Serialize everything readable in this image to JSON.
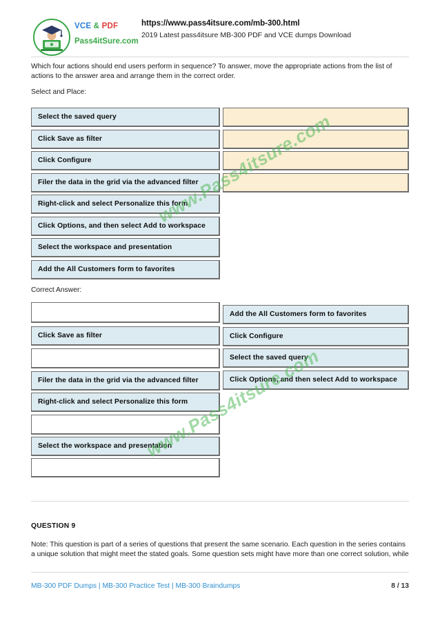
{
  "header": {
    "brand": {
      "vce": "VCE",
      "amp": "&",
      "pdf": "PDF",
      "site": "Pass4itSure.com"
    },
    "url": "https://www.pass4itsure.com/mb-300.html",
    "subtitle": "2019 Latest pass4itsure MB-300 PDF and VCE dumps Download",
    "logo_icon": "graduate-laptop-icon"
  },
  "question": {
    "prompt": "Which four actions should end users perform in sequence? To answer, move the appropriate actions from the list of actions to the answer area and arrange them in the correct order.",
    "select_and_place_label": "Select and Place:",
    "correct_answer_label": "Correct Answer:"
  },
  "select_and_place": {
    "actions_list": [
      "Select the saved query",
      "Click Save as filter",
      "Click Configure",
      "Filer the data in the grid via the advanced filter",
      "Right-click and select Personalize this form",
      "Click Options, and then select Add to workspace",
      "Select the workspace and presentation",
      "Add the All Customers form to favorites"
    ],
    "answer_slots": [
      "",
      "",
      "",
      ""
    ]
  },
  "correct_answer": {
    "left_column": [
      {
        "label": "",
        "filled": false
      },
      {
        "label": "Click Save as filter",
        "filled": true
      },
      {
        "label": "",
        "filled": false
      },
      {
        "label": "Filer the data in the grid via the advanced filter",
        "filled": true
      },
      {
        "label": "Right-click and select Personalize this form",
        "filled": true
      },
      {
        "label": "",
        "filled": false
      },
      {
        "label": "Select the workspace and presentation",
        "filled": true
      },
      {
        "label": "",
        "filled": false
      }
    ],
    "right_column": [
      "Add the All Customers form to favorites",
      "Click Configure",
      "Select the saved query",
      "Click Options, and then select Add to workspace"
    ]
  },
  "question9": {
    "title": "QUESTION 9",
    "body": "Note: This question is part of a series of questions that present the same scenario. Each question in the series contains a unique solution that might meet the stated goals. Some question sets might have more than one correct solution, while"
  },
  "watermark": {
    "text": "www.Pass4itsure.com"
  },
  "footer": {
    "link1": "MB-300 PDF Dumps",
    "link2": "MB-300 Practice Test",
    "link3": "MB-300 Braindumps",
    "separator": "|",
    "page": "8 / 13"
  },
  "colors": {
    "blue_box": "#dcebf1",
    "cream_box": "#fbeed2",
    "brand_green": "#3aa84a",
    "brand_blue": "#2a7fd4",
    "brand_red": "#e03b3b",
    "link_blue": "#2f8fd0"
  }
}
